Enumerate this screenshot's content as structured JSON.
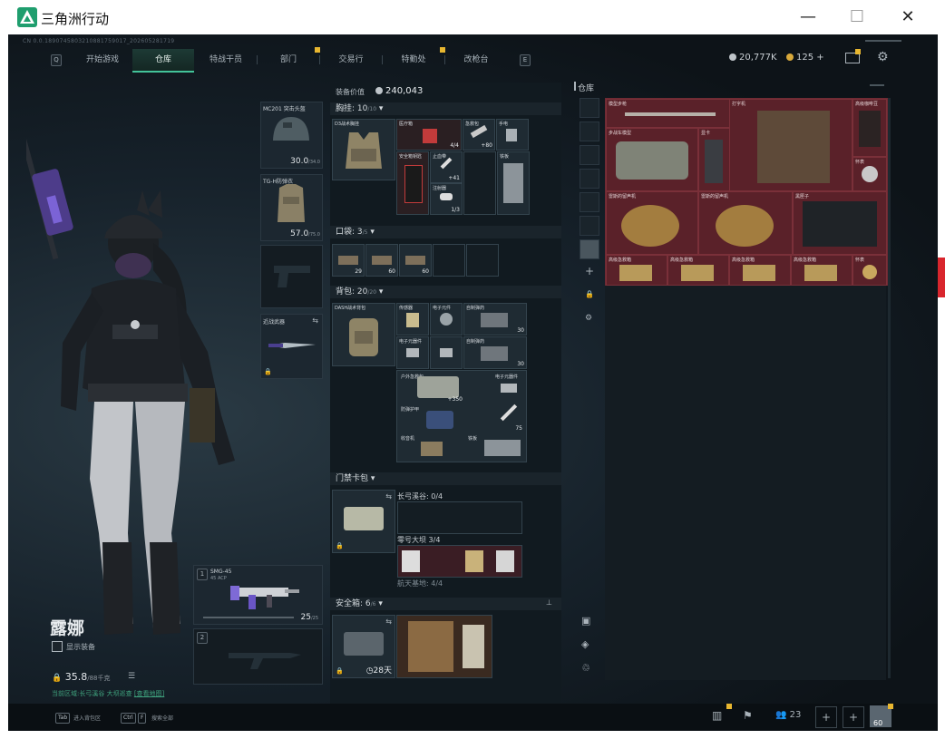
{
  "window": {
    "title": "三角洲行动",
    "controls": [
      "minimize-icon",
      "maximize-icon",
      "close-icon"
    ]
  },
  "build_info": "CN 0.0.1890745803210881759017_202605281719",
  "nav": {
    "left_key": "Q",
    "right_key": "E",
    "tabs": [
      {
        "label": "开始游戏",
        "badge": false,
        "active": false
      },
      {
        "label": "仓库",
        "badge": false,
        "active": true
      },
      {
        "label": "特战干员",
        "badge": false,
        "active": false
      },
      {
        "label": "部门",
        "badge": true,
        "active": false
      },
      {
        "label": "交易行",
        "badge": false,
        "active": false
      },
      {
        "label": "特勤处",
        "badge": true,
        "active": false
      },
      {
        "label": "改枪台",
        "badge": false,
        "active": false
      }
    ]
  },
  "currency": {
    "silver": "20,777K",
    "gold": "125",
    "plus": "+"
  },
  "operator": {
    "name": "露娜",
    "show_gear_label": "显示装备",
    "weight": "35.8",
    "weight_max": "/88千克"
  },
  "bottom_note": {
    "text": "当前区域:长弓溪谷 大坝巡查",
    "link": "[查看地图]"
  },
  "equipment": {
    "helmet": {
      "name": "MC201 突击头盔",
      "val": "30.0",
      "max": "/34.0"
    },
    "armor": {
      "name": "TG-H防弹衣",
      "val": "57.0",
      "max": "/75.0"
    },
    "melee": {
      "name": "近战武器"
    },
    "primary": {
      "slot": "1",
      "name": "SMG-45",
      "sub": "45 ACP",
      "ammo": "25",
      "ammo_max": "/25"
    },
    "secondary": {
      "slot": "2"
    }
  },
  "gear_panel": {
    "value_label": "装备价值",
    "value": "240,043",
    "chest": {
      "label": "胸挂",
      "cap": "10",
      "cap_max": "/10",
      "rig_name": "D3战术胸挂",
      "items": [
        {
          "label": "医疗箱",
          "count": "4/4"
        },
        {
          "label": "急救包",
          "count": "+80"
        },
        {
          "label": "手电",
          "count": ""
        },
        {
          "label": "安全箱钥匙",
          "count": ""
        },
        {
          "label": "止血带",
          "count": "+41"
        },
        {
          "label": "注射器",
          "count": "1/3"
        },
        {
          "label": "铁板",
          "count": ""
        }
      ]
    },
    "pockets": {
      "label": "口袋",
      "cap": "3",
      "cap_max": "/5",
      "items": [
        {
          "count": "29"
        },
        {
          "count": "60"
        },
        {
          "count": "60"
        }
      ]
    },
    "backpack": {
      "label": "背包",
      "cap": "20",
      "cap_max": "/20",
      "bag_name": "DASH战术背包",
      "items": [
        {
          "label": "传感器",
          "count": ""
        },
        {
          "label": "电子元件",
          "count": ""
        },
        {
          "label": "自制弹药",
          "count": "30"
        },
        {
          "label": "电子元器件",
          "count": ""
        },
        {
          "label": "自制弹药",
          "count": "30"
        },
        {
          "label": "户外急救包",
          "count": "+350"
        },
        {
          "label": "电子元器件",
          "count": ""
        },
        {
          "label": "防弹护甲",
          "count": ""
        },
        {
          "label": "钥匙",
          "count": "75"
        },
        {
          "label": "收音机",
          "count": ""
        },
        {
          "label": "铁板",
          "count": ""
        }
      ]
    },
    "keycase": {
      "label": "门禁卡包",
      "rows": [
        {
          "map": "长弓溪谷",
          "count": "0/4"
        },
        {
          "map": "零号大坝",
          "count": "3/4"
        },
        {
          "map": "航天基地",
          "count": "4/4"
        }
      ]
    },
    "safebox": {
      "label": "安全箱",
      "cap": "6",
      "cap_max": "/6",
      "timer": "28天"
    }
  },
  "storage": {
    "label": "仓库",
    "items": [
      {
        "label": "模型步枪"
      },
      {
        "label": "打字机"
      },
      {
        "label": "高级咖啡豆"
      },
      {
        "label": "步战车模型"
      },
      {
        "label": "显卡"
      },
      {
        "label": "怀表"
      },
      {
        "label": "雷斯的留声机"
      },
      {
        "label": "雷斯的留声机"
      },
      {
        "label": "黑匣子"
      },
      {
        "label": "高级急救箱"
      },
      {
        "label": "高级急救箱"
      },
      {
        "label": "高级急救箱"
      },
      {
        "label": "高级急救箱"
      },
      {
        "label": "怀表"
      }
    ]
  },
  "footer": {
    "hint1_key": "Tab",
    "hint1": "进入背包区",
    "hint2_key": "Ctrl",
    "hint2_key2": "F",
    "hint2": "搜索全部",
    "friends": "23",
    "level": "60"
  },
  "colors": {
    "accent": "#43c39a",
    "badge": "#e8b730",
    "storage_bg": "#4a1a22",
    "panel": "#111a20"
  }
}
